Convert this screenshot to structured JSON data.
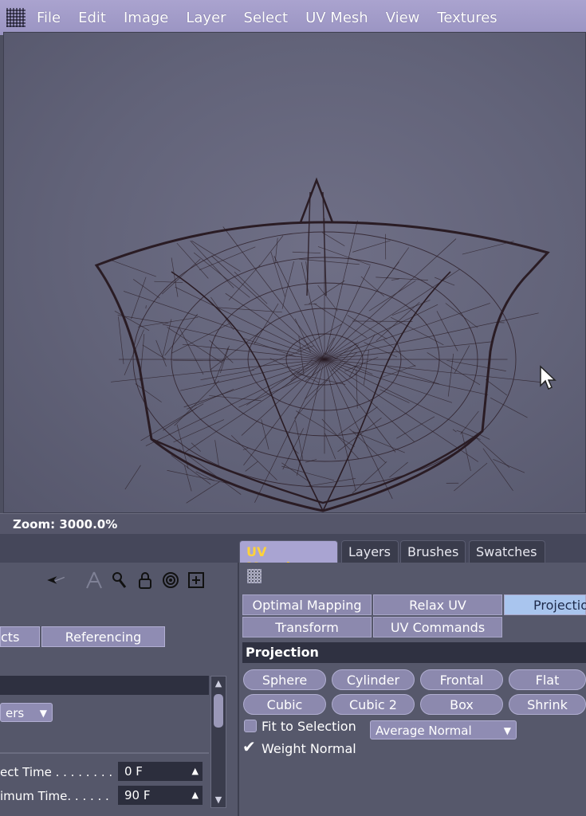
{
  "menu": {
    "items": [
      "File",
      "Edit",
      "Image",
      "Layer",
      "Select",
      "UV Mesh",
      "View",
      "Textures"
    ]
  },
  "viewport": {
    "zoom_text": "Zoom: 3000.0%"
  },
  "tabs": [
    {
      "label": "UV Mapping",
      "active": true
    },
    {
      "label": "Layers",
      "active": false
    },
    {
      "label": "Brushes",
      "active": false
    },
    {
      "label": "Swatches",
      "active": false
    }
  ],
  "left_panel": {
    "tab_partial": "cts",
    "tab_referencing": "Referencing",
    "layers_dropdown": "ers",
    "rows": [
      {
        "label": "ect Time . . . . . . . .",
        "value": "0 F"
      },
      {
        "label": "imum Time. . . . . .",
        "value": "90 F"
      }
    ]
  },
  "right_panel": {
    "subtabs_row1": [
      "Optimal Mapping",
      "Relax UV",
      "Projectio"
    ],
    "subtabs_row2": [
      "Transform",
      "UV Commands"
    ],
    "section_title": "Projection",
    "buttons_row1": [
      "Sphere",
      "Cylinder",
      "Frontal",
      "Flat"
    ],
    "buttons_row2": [
      "Cubic",
      "Cubic 2",
      "Box",
      "Shrink"
    ],
    "fit_to_selection": {
      "label": "Fit to Selection",
      "checked": false
    },
    "normal_dropdown": "Average Normal",
    "weight_normal": {
      "label": "Weight Normal",
      "checked": true
    }
  },
  "colors": {
    "menubar": "#9a94c2",
    "active_tab_text": "#ffd23a",
    "wire": "#2a1c24"
  }
}
